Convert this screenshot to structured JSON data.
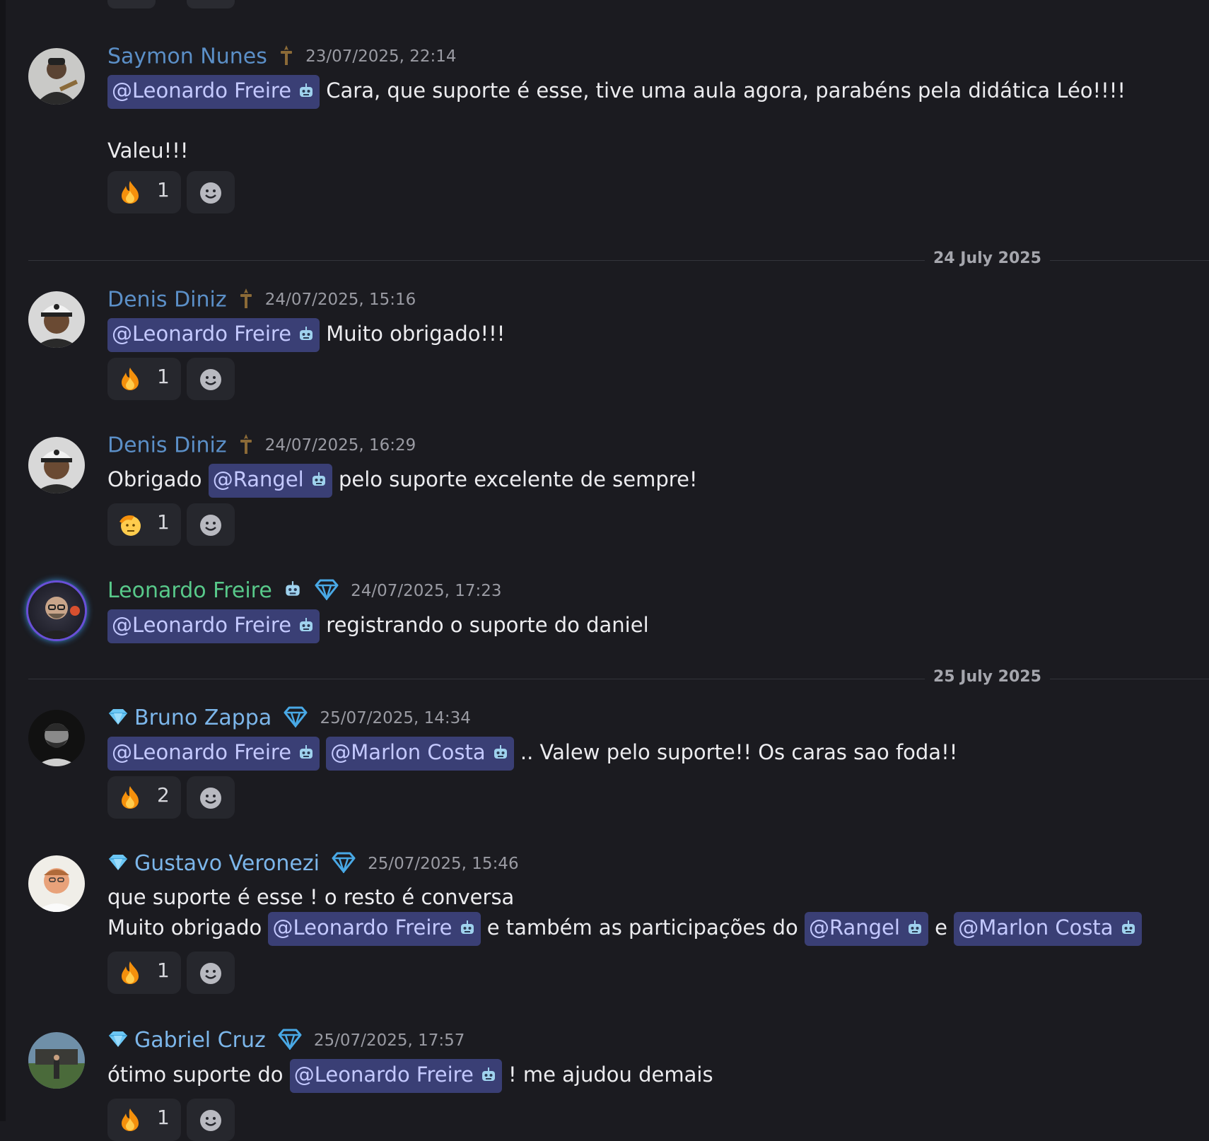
{
  "dividers": [
    {
      "label": "24 July 2025"
    },
    {
      "label": "25 July 2025"
    }
  ],
  "messages": [
    {
      "author": "Saymon Nunes",
      "timestamp": "23/07/2025, 22:14",
      "lines": {
        "l1_mention": "@Leonardo Freire",
        "l1_text": " Cara, que suporte é esse, tive uma aula agora, parabéns pela didática Léo!!!!",
        "l2_text": "Valeu!!!"
      },
      "reaction": {
        "emoji": "fire",
        "count": "1"
      }
    },
    {
      "author": "Denis Diniz",
      "timestamp": "24/07/2025, 15:16",
      "lines": {
        "l1_mention": "@Leonardo Freire",
        "l1_text": " Muito obrigado!!!"
      },
      "reaction": {
        "emoji": "fire",
        "count": "1"
      }
    },
    {
      "author": "Denis Diniz",
      "timestamp": "24/07/2025, 16:29",
      "lines": {
        "l1_pre": "Obrigado ",
        "l1_mention": "@Rangel",
        "l1_text": " pelo suporte excelente de sempre!"
      },
      "reaction": {
        "emoji": "saluting-face",
        "count": "1"
      }
    },
    {
      "author": "Leonardo Freire",
      "timestamp": "24/07/2025, 17:23",
      "lines": {
        "l1_mention": "@Leonardo Freire",
        "l1_text": " registrando o suporte do daniel"
      }
    },
    {
      "author": "Bruno Zappa",
      "timestamp": "25/07/2025, 14:34",
      "lines": {
        "l1_mention": "@Leonardo Freire",
        "l1_mention2": "@Marlon Costa",
        "l1_text": " .. Valew pelo suporte!! Os caras sao foda!!"
      },
      "reaction": {
        "emoji": "fire",
        "count": "2"
      }
    },
    {
      "author": "Gustavo Veronezi",
      "timestamp": "25/07/2025, 15:46",
      "lines": {
        "l1_text": "que suporte é esse ! o resto é conversa",
        "l2_pre": "Muito obrigado ",
        "l2_mention": "@Leonardo Freire",
        "l2_mid": " e também as participações do ",
        "l2_mention2": "@Rangel",
        "l2_and": " e ",
        "l2_mention3": "@Marlon Costa"
      },
      "reaction": {
        "emoji": "fire",
        "count": "1"
      }
    },
    {
      "author": "Gabriel Cruz",
      "timestamp": "25/07/2025, 17:57",
      "lines": {
        "l1_pre": "ótimo suporte do ",
        "l1_mention": "@Leonardo Freire",
        "l1_text": " ! me ajudou demais"
      },
      "reaction": {
        "emoji": "fire",
        "count": "1"
      }
    }
  ],
  "icons": {
    "role_badge": "torch-badge-icon",
    "booster": "diamond-icon",
    "bot": "robot-icon",
    "add_reaction": "smiley-icon"
  },
  "colors": {
    "background": "#1b1b20",
    "mention_bg": "#3a3f75",
    "mention_fg": "#c4c9ff",
    "author_blue": "#5b8fc7",
    "author_green": "#58c98a",
    "author_sky": "#7cb6ea"
  }
}
